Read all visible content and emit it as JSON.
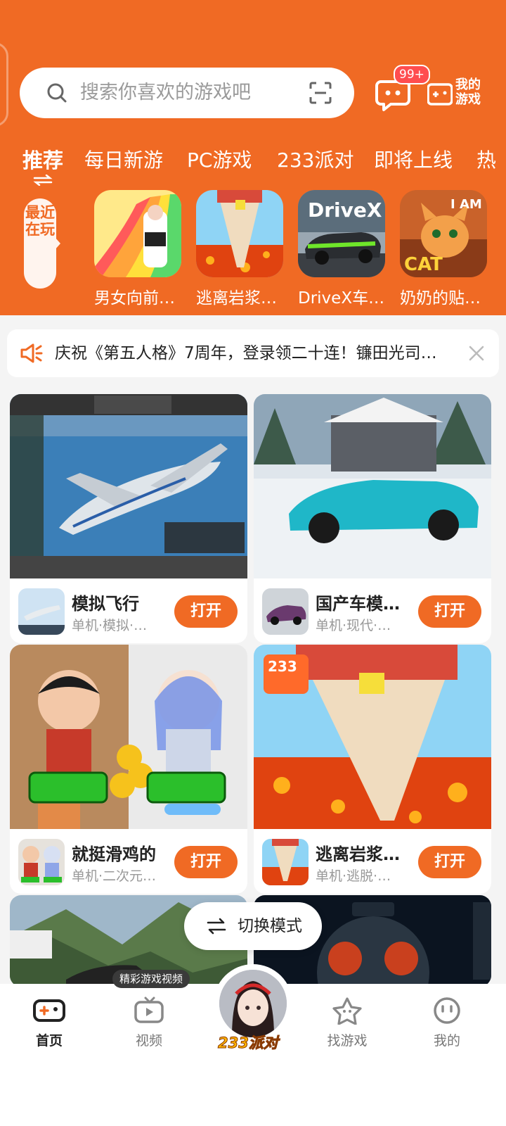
{
  "colors": {
    "accent": "#f06a24",
    "badge": "#ff4d4f",
    "background": "#f4f4f4"
  },
  "search": {
    "placeholder": "搜索你喜欢的游戏吧"
  },
  "header": {
    "message_badge": "99+",
    "my_games_label": "我的游戏"
  },
  "tabs": [
    "推荐",
    "每日新游",
    "PC游戏",
    "233派对",
    "即将上线",
    "热"
  ],
  "recent": {
    "label": "最近在玩",
    "items": [
      {
        "label": "男女向前…"
      },
      {
        "label": "逃离岩浆…"
      },
      {
        "label": "DriveX车…"
      },
      {
        "label": "奶奶的贴…"
      }
    ]
  },
  "notice": {
    "text": "庆祝《第五人格》7周年，登录领二十连！镰田光司…"
  },
  "cards": [
    {
      "name": "模拟飞行",
      "tags": "单机·模拟·…",
      "button": "打开"
    },
    {
      "name": "国产车模…",
      "tags": "单机·现代·…",
      "button": "打开"
    },
    {
      "name": "就挺滑鸡的",
      "tags": "单机·二次元…",
      "button": "打开"
    },
    {
      "name": "逃离岩浆…",
      "tags": "单机·逃脱·…",
      "button": "打开"
    }
  ],
  "switch_mode": {
    "label": "切换模式"
  },
  "video_tip": "精彩游戏视频",
  "bottom_nav": [
    {
      "label": "首页",
      "icon": "gamepad-icon",
      "active": true
    },
    {
      "label": "视频",
      "icon": "video-icon"
    },
    {
      "label": "233派对",
      "icon": "party-avatar"
    },
    {
      "label": "找游戏",
      "icon": "star-icon"
    },
    {
      "label": "我的",
      "icon": "smile-icon"
    }
  ]
}
